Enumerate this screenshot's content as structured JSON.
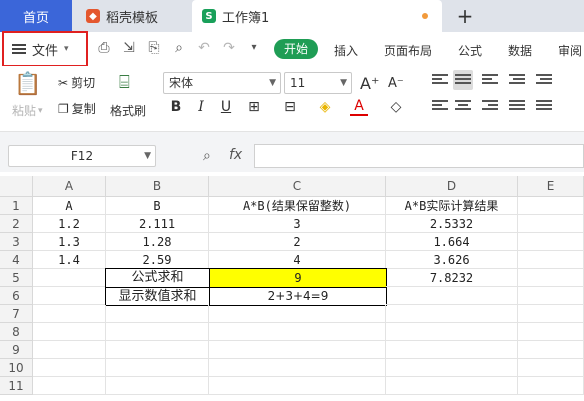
{
  "tabs": {
    "home": "首页",
    "template": "稻壳模板",
    "workbook": "工作簿1",
    "new_tab": "+"
  },
  "menu": {
    "file": "文件",
    "start": "开始",
    "items": [
      "插入",
      "页面布局",
      "公式",
      "数据",
      "审阅"
    ]
  },
  "ribbon": {
    "paste": "粘贴",
    "cut": "剪切",
    "copy": "复制",
    "format_painter": "格式刷",
    "font_name": "宋体",
    "font_size": "11",
    "bold": "B",
    "italic": "I",
    "underline": "U",
    "font_color_glyph": "A",
    "grow_font": "A⁺",
    "shrink_font": "A⁻"
  },
  "formula_bar": {
    "name_box": "F12",
    "fx": "fx",
    "content": ""
  },
  "sheet": {
    "columns": [
      "A",
      "B",
      "C",
      "D",
      "E"
    ],
    "rows": [
      "1",
      "2",
      "3",
      "4",
      "5",
      "6",
      "7",
      "8",
      "9",
      "10",
      "11"
    ],
    "cells": {
      "A1": "A",
      "B1": "B",
      "C1": "A*B(结果保留整数)",
      "D1": "A*B实际计算结果",
      "A2": "1.2",
      "B2": "2.111",
      "C2": "3",
      "D2": "2.5332",
      "A3": "1.3",
      "B3": "1.28",
      "C3": "2",
      "D3": "1.664",
      "A4": "1.4",
      "B4": "2.59",
      "C4": "4",
      "D4": "3.626",
      "B5": "公式求和",
      "C5": "9",
      "D5": "7.8232",
      "B6": "显示数值求和",
      "C6": "2+3+4=9"
    }
  },
  "colors": {
    "home_tab": "#3b66d9",
    "start_button": "#1f9d55",
    "highlight_cell": "#ffff00",
    "file_outline": "#e02020"
  }
}
